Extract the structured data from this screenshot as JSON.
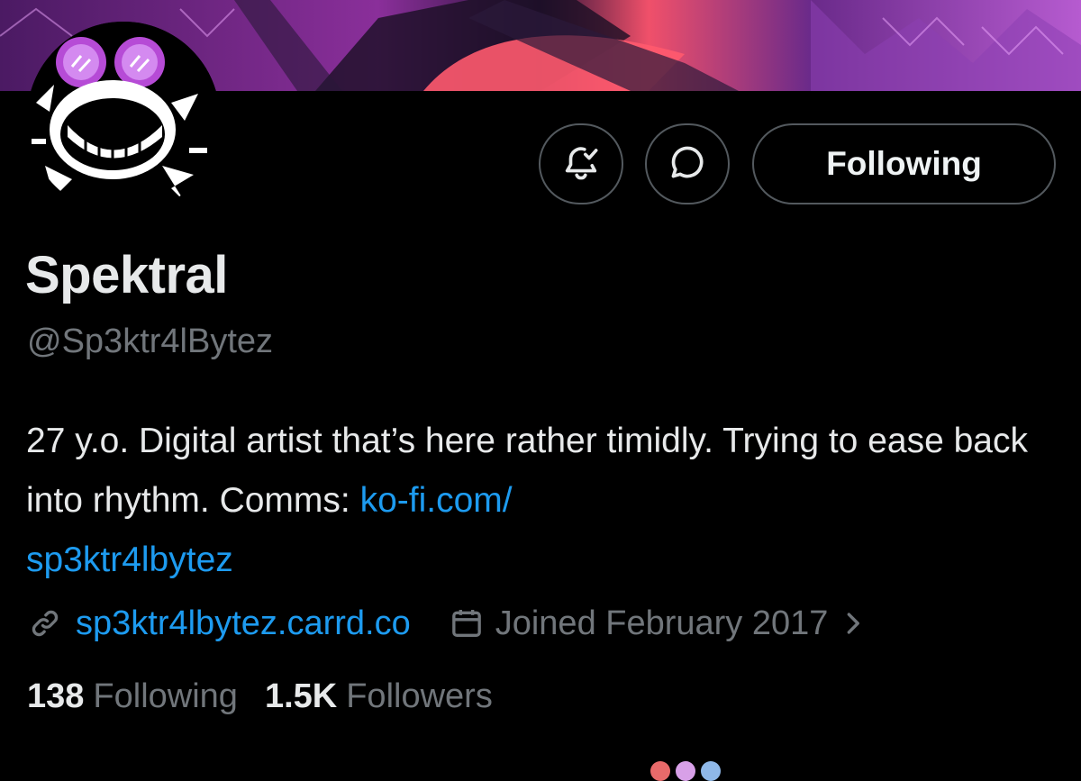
{
  "profile": {
    "display_name": "Spektral",
    "handle": "@Sp3ktr4lBytez",
    "bio_text": "27 y.o. Digital artist that’s here rather timidly. Trying to ease back into rhythm. Comms: ",
    "bio_link_line1": "ko-fi.com/",
    "bio_link_line2": "sp3ktr4lbytez",
    "website": "sp3ktr4lbytez.carrd.co",
    "joined": "Joined February 2017"
  },
  "actions": {
    "notify_icon": "bell-check-icon",
    "message_icon": "chat-bubble-icon",
    "following_label": "Following"
  },
  "stats": {
    "following_count": "138",
    "following_label": "Following",
    "followers_count": "1.5K",
    "followers_label": "Followers"
  },
  "icons": {
    "link": "link-icon",
    "calendar": "calendar-icon",
    "chevron": "chevron-right-icon"
  },
  "colors": {
    "background": "#000000",
    "text_primary": "#e7e9ea",
    "text_secondary": "#71767b",
    "link_blue": "#1d9bf0",
    "button_border": "#53595e"
  }
}
